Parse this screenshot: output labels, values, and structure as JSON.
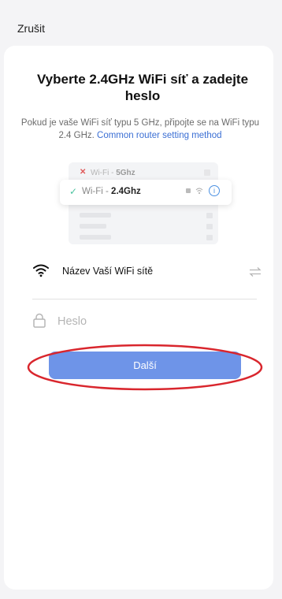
{
  "header": {
    "cancel_label": "Zrušit"
  },
  "card": {
    "title": "Vyberte 2.4GHz WiFi síť a zadejte heslo",
    "subtitle_text": "Pokud je vaše WiFi síť typu 5 GHz, připojte se na WiFi typu 2.4 GHz.",
    "subtitle_link": "Common router setting method"
  },
  "illustration": {
    "row_5ghz": {
      "prefix": "Wi-Fi - ",
      "band": "5Ghz",
      "status_icon": "cross-icon"
    },
    "row_24ghz": {
      "prefix": "Wi-Fi - ",
      "band": "2.4Ghz",
      "status_icon": "check-icon"
    }
  },
  "form": {
    "wifi_name": "Název Vaší WiFi sítě",
    "password_placeholder": "Heslo",
    "password_value": "",
    "next_label": "Další"
  },
  "colors": {
    "accent": "#6e94e8",
    "link": "#3b6fd4",
    "highlight": "#d9262d"
  }
}
